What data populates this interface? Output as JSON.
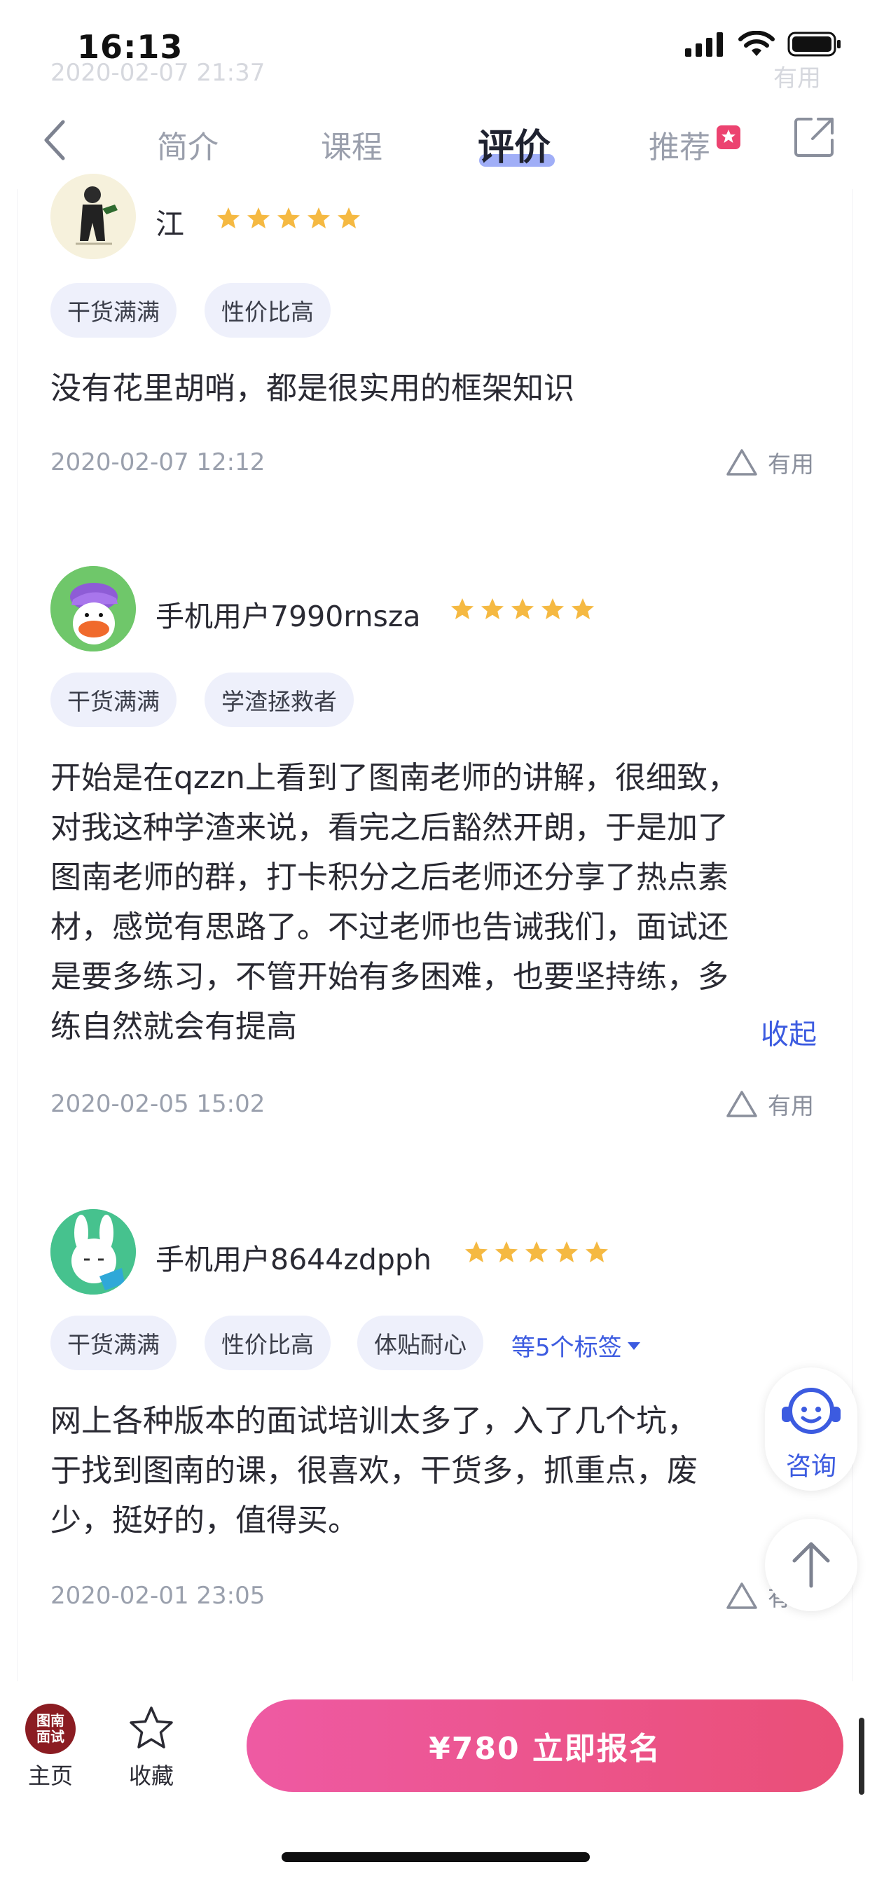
{
  "status": {
    "time": "16:13"
  },
  "ghost": {
    "date": "2020-02-07 21:37",
    "useful": "有用"
  },
  "nav": {
    "tabs": [
      "简介",
      "课程",
      "评价",
      "推荐"
    ],
    "active": "评价"
  },
  "reviews": [
    {
      "user": "江",
      "rating": 5,
      "tags": [
        "干货满满",
        "性价比高"
      ],
      "text": [
        "没有花里胡哨，都是很实用的框架知识"
      ],
      "date": "2020-02-07 12:12",
      "useful": "有用"
    },
    {
      "user": "手机用户7990rnsza",
      "rating": 5,
      "tags": [
        "干货满满",
        "学渣拯救者"
      ],
      "text": [
        "开始是在qzzn上看到了图南老师的讲解，很细致，",
        "对我这种学渣来说，看完之后豁然开朗，于是加了",
        "图南老师的群，打卡积分之后老师还分享了热点素",
        "材，感觉有思路了。不过老师也告诫我们，面试还",
        "是要多练习，不管开始有多困难，也要坚持练，多",
        "练自然就会有提高"
      ],
      "collapse": "收起",
      "date": "2020-02-05 15:02",
      "useful": "有用"
    },
    {
      "user": "手机用户8644zdpph",
      "rating": 5,
      "tags": [
        "干货满满",
        "性价比高",
        "体贴耐心"
      ],
      "more_tags": "等5个标签",
      "text": [
        "网上各种版本的面试培训太多了，入了几个坑，",
        "于找到图南的课，很喜欢，干货多，抓重点，废",
        "少，挺好的，值得买。"
      ],
      "date": "2020-02-01 23:05",
      "useful": "有"
    }
  ],
  "float": {
    "consult": "咨询"
  },
  "bottom": {
    "logo_text": [
      "图南",
      "面试"
    ],
    "home": "主页",
    "favorite": "收藏",
    "enroll": "¥780 立即报名"
  },
  "colors": {
    "accent": "#3c5be0",
    "star": "#f5b942",
    "enroll_start": "#ee5aa3",
    "enroll_end": "#ea4f77",
    "tag_bg": "#eef0fb"
  }
}
